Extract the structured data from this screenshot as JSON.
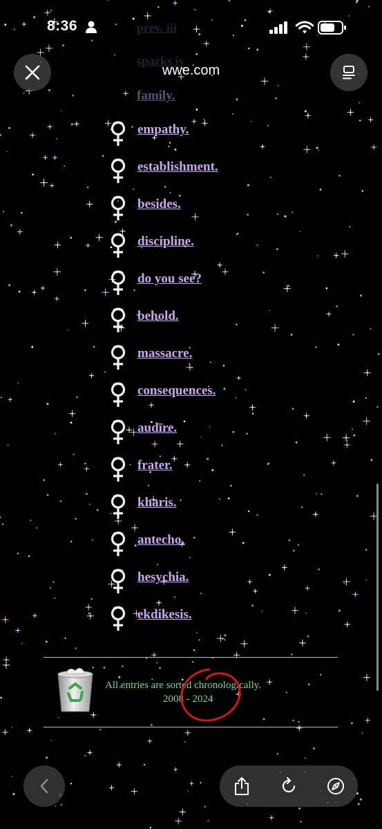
{
  "status_bar": {
    "time": "8:36"
  },
  "browser": {
    "domain": "wwe.com"
  },
  "background_ghost": {
    "items": [
      "prev. iii",
      "sparks iv"
    ]
  },
  "partial_item": "family.",
  "entries": [
    "empathy.",
    "establishment.",
    "besides.",
    "discipline.",
    "do you see?",
    "behold.",
    "massacre.",
    "consequences.",
    "audīre.",
    "frater.",
    "kharis.",
    "antecho.",
    "hesychia.",
    "ekdikesis."
  ],
  "footer": {
    "line1": "All entries are sorted chronologically.",
    "line2": "2008 - 2024"
  },
  "colors": {
    "link": "#c8a6f0",
    "footer_text": "#7cd690",
    "annotation": "#d01818",
    "background": "#000000"
  }
}
